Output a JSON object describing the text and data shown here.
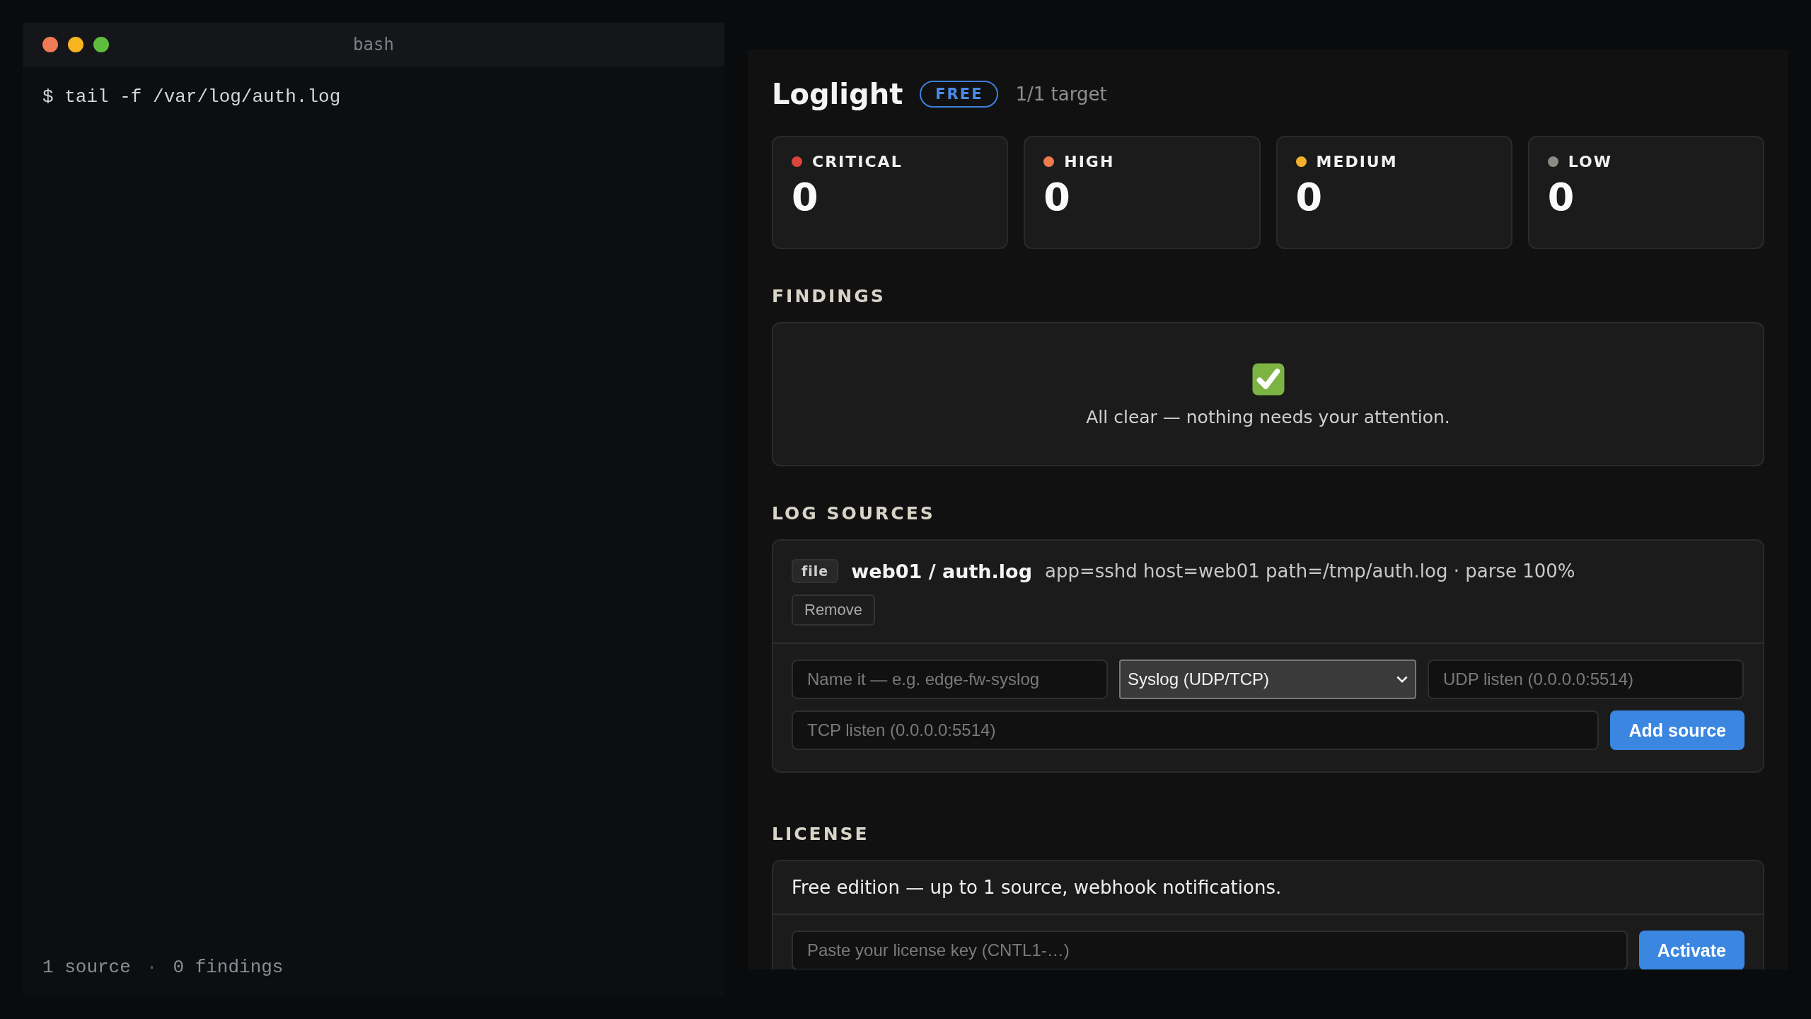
{
  "terminal": {
    "title": "bash",
    "command": "$ tail -f /var/log/auth.log",
    "status": [
      "1 source",
      "0 findings"
    ],
    "separator": "·"
  },
  "app": {
    "title": "Loglight",
    "plan_badge": "FREE",
    "targets": "1/1 target"
  },
  "severities": [
    {
      "label": "CRITICAL",
      "count": "0",
      "color": "#d9443c"
    },
    {
      "label": "HIGH",
      "count": "0",
      "color": "#ee7b50"
    },
    {
      "label": "MEDIUM",
      "count": "0",
      "color": "#f1b12a"
    },
    {
      "label": "LOW",
      "count": "0",
      "color": "#8c8c84"
    }
  ],
  "findings": {
    "heading": "FINDINGS",
    "empty_message": "All clear — nothing needs your attention."
  },
  "log_sources": {
    "heading": "LOG SOURCES",
    "sources": [
      {
        "type": "file",
        "name": "web01 / auth.log",
        "details": "app=sshd host=web01 path=/tmp/auth.log · parse 100%",
        "remove": "Remove"
      }
    ],
    "form": {
      "name_placeholder": "Name it — e.g. edge-fw-syslog",
      "type_value": "Syslog (UDP/TCP)",
      "udp_placeholder": "UDP listen (0.0.0.0:5514)",
      "tcp_placeholder": "TCP listen (0.0.0.0:5514)",
      "submit": "Add source"
    }
  },
  "license": {
    "heading": "LICENSE",
    "description": "Free edition — up to 1 source, webhook notifications.",
    "key_placeholder": "Paste your license key (CNTL1-…)",
    "submit": "Activate"
  }
}
